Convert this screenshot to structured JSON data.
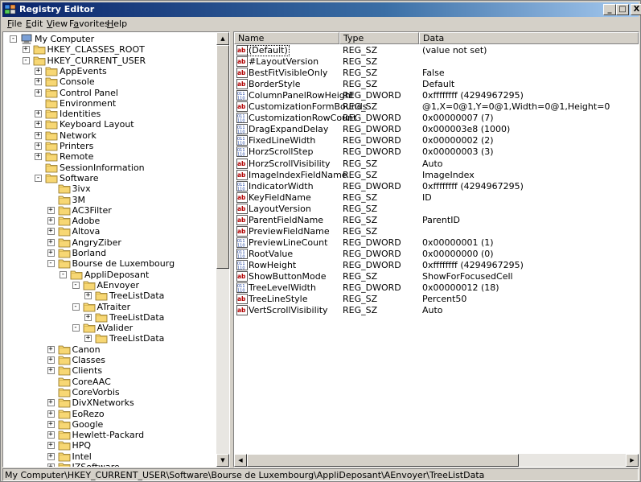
{
  "window": {
    "title": "Registry Editor"
  },
  "title_buttons": {
    "minimize": "_",
    "maximize": "□",
    "close": "X"
  },
  "menu": [
    {
      "accel": "F",
      "rest": "ile"
    },
    {
      "accel": "E",
      "rest": "dit"
    },
    {
      "accel": "V",
      "rest": "iew"
    },
    {
      "pre": "F",
      "accel": "a",
      "rest": "vorites"
    },
    {
      "accel": "H",
      "rest": "elp"
    }
  ],
  "tree": [
    {
      "level": 0,
      "exp": "-",
      "label": "My Computer",
      "icon": "computer-icon"
    },
    {
      "level": 1,
      "exp": "+",
      "label": "HKEY_CLASSES_ROOT"
    },
    {
      "level": 1,
      "exp": "-",
      "label": "HKEY_CURRENT_USER"
    },
    {
      "level": 2,
      "exp": "+",
      "label": "AppEvents"
    },
    {
      "level": 2,
      "exp": "+",
      "label": "Console"
    },
    {
      "level": 2,
      "exp": "+",
      "label": "Control Panel"
    },
    {
      "level": 2,
      "exp": "",
      "label": "Environment"
    },
    {
      "level": 2,
      "exp": "+",
      "label": "Identities"
    },
    {
      "level": 2,
      "exp": "+",
      "label": "Keyboard Layout"
    },
    {
      "level": 2,
      "exp": "+",
      "label": "Network"
    },
    {
      "level": 2,
      "exp": "+",
      "label": "Printers"
    },
    {
      "level": 2,
      "exp": "+",
      "label": "Remote"
    },
    {
      "level": 2,
      "exp": "",
      "label": "SessionInformation"
    },
    {
      "level": 2,
      "exp": "-",
      "label": "Software"
    },
    {
      "level": 3,
      "exp": "",
      "label": "3ivx"
    },
    {
      "level": 3,
      "exp": "",
      "label": "3M"
    },
    {
      "level": 3,
      "exp": "+",
      "label": "AC3Filter"
    },
    {
      "level": 3,
      "exp": "+",
      "label": "Adobe"
    },
    {
      "level": 3,
      "exp": "+",
      "label": "Altova"
    },
    {
      "level": 3,
      "exp": "+",
      "label": "AngryZiber"
    },
    {
      "level": 3,
      "exp": "+",
      "label": "Borland"
    },
    {
      "level": 3,
      "exp": "-",
      "label": "Bourse de Luxembourg"
    },
    {
      "level": 4,
      "exp": "-",
      "label": "AppliDeposant"
    },
    {
      "level": 5,
      "exp": "-",
      "label": "AEnvoyer"
    },
    {
      "level": 6,
      "exp": "+",
      "label": "TreeListData"
    },
    {
      "level": 5,
      "exp": "-",
      "label": "ATraiter"
    },
    {
      "level": 6,
      "exp": "+",
      "label": "TreeListData"
    },
    {
      "level": 5,
      "exp": "-",
      "label": "AValider"
    },
    {
      "level": 6,
      "exp": "+",
      "label": "TreeListData"
    },
    {
      "level": 3,
      "exp": "+",
      "label": "Canon"
    },
    {
      "level": 3,
      "exp": "+",
      "label": "Classes"
    },
    {
      "level": 3,
      "exp": "+",
      "label": "Clients"
    },
    {
      "level": 3,
      "exp": "",
      "label": "CoreAAC"
    },
    {
      "level": 3,
      "exp": "",
      "label": "CoreVorbis"
    },
    {
      "level": 3,
      "exp": "+",
      "label": "DivXNetworks"
    },
    {
      "level": 3,
      "exp": "+",
      "label": "EoRezo"
    },
    {
      "level": 3,
      "exp": "+",
      "label": "Google"
    },
    {
      "level": 3,
      "exp": "+",
      "label": "Hewlett-Packard"
    },
    {
      "level": 3,
      "exp": "+",
      "label": "HPQ"
    },
    {
      "level": 3,
      "exp": "+",
      "label": "Intel"
    },
    {
      "level": 3,
      "exp": "+",
      "label": "IZSoftware"
    }
  ],
  "columns": {
    "name": "Name",
    "type": "Type",
    "data": "Data"
  },
  "values": [
    {
      "icon": "string-value-icon",
      "name": "(Default)",
      "type": "REG_SZ",
      "data": "(value not set)"
    },
    {
      "icon": "string-value-icon",
      "name": "#LayoutVersion",
      "type": "REG_SZ",
      "data": ""
    },
    {
      "icon": "string-value-icon",
      "name": "BestFitVisibleOnly",
      "type": "REG_SZ",
      "data": "False"
    },
    {
      "icon": "string-value-icon",
      "name": "BorderStyle",
      "type": "REG_SZ",
      "data": "Default"
    },
    {
      "icon": "dword-value-icon",
      "name": "ColumnPanelRowHeight",
      "type": "REG_DWORD",
      "data": "0xffffffff (4294967295)"
    },
    {
      "icon": "string-value-icon",
      "name": "CustomizationFormBounds",
      "type": "REG_SZ",
      "data": "@1,X=0@1,Y=0@1,Width=0@1,Height=0"
    },
    {
      "icon": "dword-value-icon",
      "name": "CustomizationRowCount",
      "type": "REG_DWORD",
      "data": "0x00000007 (7)"
    },
    {
      "icon": "dword-value-icon",
      "name": "DragExpandDelay",
      "type": "REG_DWORD",
      "data": "0x000003e8 (1000)"
    },
    {
      "icon": "dword-value-icon",
      "name": "FixedLineWidth",
      "type": "REG_DWORD",
      "data": "0x00000002 (2)"
    },
    {
      "icon": "dword-value-icon",
      "name": "HorzScrollStep",
      "type": "REG_DWORD",
      "data": "0x00000003 (3)"
    },
    {
      "icon": "string-value-icon",
      "name": "HorzScrollVisibility",
      "type": "REG_SZ",
      "data": "Auto"
    },
    {
      "icon": "string-value-icon",
      "name": "ImageIndexFieldName",
      "type": "REG_SZ",
      "data": "ImageIndex"
    },
    {
      "icon": "dword-value-icon",
      "name": "IndicatorWidth",
      "type": "REG_DWORD",
      "data": "0xffffffff (4294967295)"
    },
    {
      "icon": "string-value-icon",
      "name": "KeyFieldName",
      "type": "REG_SZ",
      "data": "ID"
    },
    {
      "icon": "string-value-icon",
      "name": "LayoutVersion",
      "type": "REG_SZ",
      "data": ""
    },
    {
      "icon": "string-value-icon",
      "name": "ParentFieldName",
      "type": "REG_SZ",
      "data": "ParentID"
    },
    {
      "icon": "string-value-icon",
      "name": "PreviewFieldName",
      "type": "REG_SZ",
      "data": ""
    },
    {
      "icon": "dword-value-icon",
      "name": "PreviewLineCount",
      "type": "REG_DWORD",
      "data": "0x00000001 (1)"
    },
    {
      "icon": "dword-value-icon",
      "name": "RootValue",
      "type": "REG_DWORD",
      "data": "0x00000000 (0)"
    },
    {
      "icon": "dword-value-icon",
      "name": "RowHeight",
      "type": "REG_DWORD",
      "data": "0xffffffff (4294967295)"
    },
    {
      "icon": "string-value-icon",
      "name": "ShowButtonMode",
      "type": "REG_SZ",
      "data": "ShowForFocusedCell"
    },
    {
      "icon": "dword-value-icon",
      "name": "TreeLevelWidth",
      "type": "REG_DWORD",
      "data": "0x00000012 (18)"
    },
    {
      "icon": "string-value-icon",
      "name": "TreeLineStyle",
      "type": "REG_SZ",
      "data": "Percent50"
    },
    {
      "icon": "string-value-icon",
      "name": "VertScrollVisibility",
      "type": "REG_SZ",
      "data": "Auto"
    }
  ],
  "status": {
    "path": "My Computer\\HKEY_CURRENT_USER\\Software\\Bourse de Luxembourg\\AppliDeposant\\AEnvoyer\\TreeListData"
  },
  "colors": {
    "titlebar_start": "#0a246a",
    "titlebar_end": "#a6caf0",
    "chrome": "#d4d0c8",
    "folder": "#f7d774"
  },
  "scroll_arrows": {
    "up": "▲",
    "down": "▼",
    "left": "◀",
    "right": "▶"
  }
}
